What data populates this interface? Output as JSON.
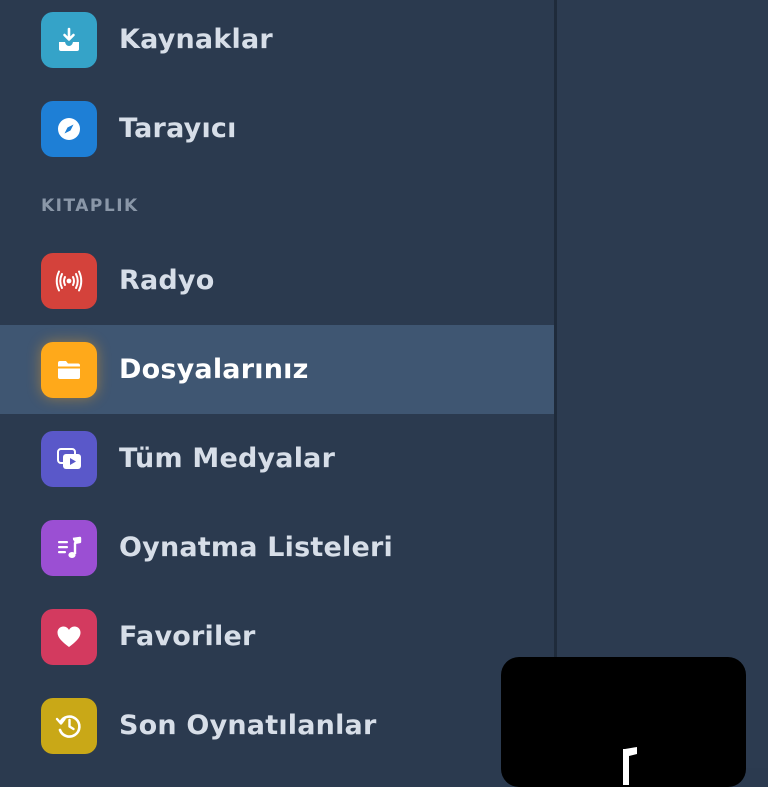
{
  "sidebar": {
    "items_top": [
      {
        "label": "Kaynaklar",
        "icon": "sources-inbox-icon",
        "color": "#35a3c8"
      },
      {
        "label": "Tarayıcı",
        "icon": "compass-icon",
        "color": "#1e7fd6"
      }
    ],
    "section_header": "KITAPLIK",
    "library_items": [
      {
        "label": "Radyo",
        "icon": "radio-broadcast-icon",
        "color": "#d4423b"
      },
      {
        "label": "Dosyalarınız",
        "icon": "folder-icon",
        "color": "#ffa91a",
        "selected": true
      },
      {
        "label": "Tüm Medyalar",
        "icon": "media-stack-icon",
        "color": "#5a58c9"
      },
      {
        "label": "Oynatma Listeleri",
        "icon": "playlist-icon",
        "color": "#9b4fd3"
      },
      {
        "label": "Favoriler",
        "icon": "heart-icon",
        "color": "#d33a5f"
      },
      {
        "label": "Son Oynatılanlar",
        "icon": "history-icon",
        "color": "#c9a817"
      }
    ]
  },
  "theme": {
    "sidebar_bg": "#2b3a4f",
    "selected_bg": "#3f5672",
    "text": "#d7dee8",
    "section_text": "#8a97a8"
  },
  "mini_player": {
    "icon": "music-note-icon"
  }
}
